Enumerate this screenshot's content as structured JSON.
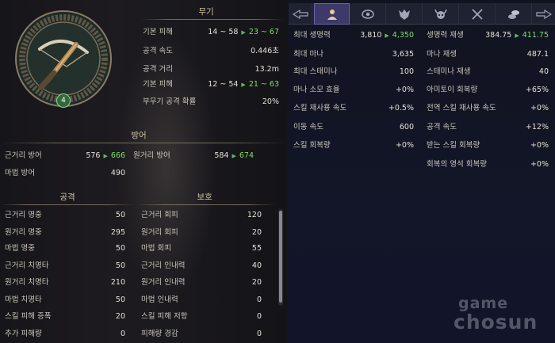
{
  "colors": {
    "accent_green": "#7fdc6a",
    "section_title": "#cfc1a4",
    "tab_active": "#3d3a6a"
  },
  "weapon": {
    "level": "4",
    "icon": "crossbow-icon",
    "title": "무기",
    "rows": [
      {
        "label": "기본 피해",
        "value": "14 ~ 58",
        "upgraded": "23 ~ 67"
      },
      {
        "label": "공격 속도",
        "value": "0.446초",
        "upgraded": null
      },
      {
        "label": "공격 거리",
        "value": "13.2m",
        "upgraded": null
      },
      {
        "label": "기본 피해",
        "value": "12 ~ 54",
        "upgraded": "21 ~ 63"
      },
      {
        "label": "부무기 공격 확률",
        "value": "20%",
        "upgraded": null
      }
    ]
  },
  "defense": {
    "title": "방어",
    "melee": {
      "label": "근거리 방어",
      "value": "576",
      "upgraded": "666"
    },
    "ranged": {
      "label": "원거리 방어",
      "value": "584",
      "upgraded": "674"
    },
    "magic": {
      "label": "마법 방어",
      "value": "490"
    }
  },
  "attack": {
    "title": "공격",
    "rows": [
      {
        "label": "근거리 명중",
        "value": "50"
      },
      {
        "label": "원거리 명중",
        "value": "295"
      },
      {
        "label": "마법 명중",
        "value": "50"
      },
      {
        "label": "근거리 치명타",
        "value": "50"
      },
      {
        "label": "원거리 치명타",
        "value": "210"
      },
      {
        "label": "마법 치명타",
        "value": "50"
      },
      {
        "label": "스킬 피해 증폭",
        "value": "20"
      },
      {
        "label": "추가 피해량",
        "value": "0"
      }
    ]
  },
  "protection": {
    "title": "보호",
    "rows": [
      {
        "label": "근거리 회피",
        "value": "120"
      },
      {
        "label": "원거리 회피",
        "value": "20"
      },
      {
        "label": "마법 회피",
        "value": "55"
      },
      {
        "label": "근거리 인내력",
        "value": "40"
      },
      {
        "label": "원거리 인내력",
        "value": "20"
      },
      {
        "label": "마법 인내력",
        "value": "0"
      },
      {
        "label": "스킬 피해 저항",
        "value": "0"
      },
      {
        "label": "피해량 경감",
        "value": "0"
      }
    ]
  },
  "tabs": [
    {
      "icon": "back-arrow-icon"
    },
    {
      "icon": "character-icon"
    },
    {
      "icon": "eye-icon"
    },
    {
      "icon": "beast-icon"
    },
    {
      "icon": "horned-skull-icon"
    },
    {
      "icon": "crossed-swords-icon"
    },
    {
      "icon": "coins-icon"
    },
    {
      "icon": "forward-arrow-icon"
    }
  ],
  "stats_left": [
    {
      "label": "최대 생명력",
      "value": "3,810",
      "upgraded": "4,350"
    },
    {
      "label": "최대 마나",
      "value": "3,635",
      "upgraded": null
    },
    {
      "label": "최대 스태미나",
      "value": "100",
      "upgraded": null
    },
    {
      "label": "마나 소모 효율",
      "value": "+0%",
      "upgraded": null
    },
    {
      "label": "스킬 재사용 속도",
      "value": "+0.5%",
      "upgraded": null
    },
    {
      "label": "이동 속도",
      "value": "600",
      "upgraded": null
    },
    {
      "label": "스킬 회복량",
      "value": "+0%",
      "upgraded": null
    }
  ],
  "stats_right": [
    {
      "label": "생명력 재생",
      "value": "384.75",
      "upgraded": "411.75"
    },
    {
      "label": "마나 재생",
      "value": "487.1",
      "upgraded": null
    },
    {
      "label": "스태미나 재생",
      "value": "40",
      "upgraded": null
    },
    {
      "label": "아미토이 회복량",
      "value": "+65%",
      "upgraded": null
    },
    {
      "label": "전역 스킬 재사용 속도",
      "value": "+0%",
      "upgraded": null
    },
    {
      "label": "공격 속도",
      "value": "+12%",
      "upgraded": null
    },
    {
      "label": "받는 스킬 회복량",
      "value": "+0%",
      "upgraded": null
    },
    {
      "label": "회복의 영석 회복량",
      "value": "+0%",
      "upgraded": null
    }
  ],
  "watermark": {
    "line1": "game",
    "line2": "chosun"
  }
}
